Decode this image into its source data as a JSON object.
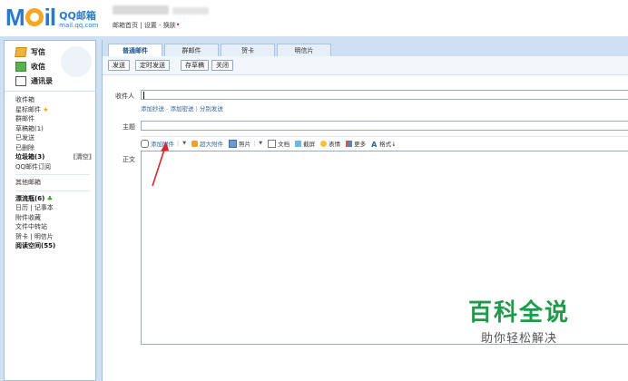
{
  "header": {
    "logo_text": "M",
    "logo_text2": "il",
    "logo_cn": "QQ邮箱",
    "logo_url": "mail.qq.com",
    "links": [
      "邮箱首页",
      "设置",
      "换肤"
    ]
  },
  "sidebar": {
    "actions": [
      {
        "label": "写信",
        "icon": "pencil-icon"
      },
      {
        "label": "收信",
        "icon": "inbox-icon"
      },
      {
        "label": "通讯录",
        "icon": "contacts-icon"
      }
    ],
    "folders": [
      {
        "label": "收件箱"
      },
      {
        "label": "星标邮件"
      },
      {
        "label": "群邮件"
      },
      {
        "label": "草稿箱(1)"
      },
      {
        "label": "已发送"
      },
      {
        "label": "已删除"
      },
      {
        "label": "垃圾箱(3)",
        "action": "[清空]"
      },
      {
        "label": "QQ邮件订阅"
      }
    ],
    "other": "其他邮箱",
    "apps": {
      "drift": "漂流瓶(6)",
      "calendar": "日历",
      "notes": "记事本",
      "attach": "附件收藏",
      "transfer": "文件中转站",
      "card": "贺卡",
      "postcard": "明信片",
      "reading": "阅读空间(55)"
    }
  },
  "tabs": [
    "普通邮件",
    "群邮件",
    "贺卡",
    "明信片"
  ],
  "toolbar": [
    "发送",
    "定时发送",
    "存草稿",
    "关闭"
  ],
  "compose": {
    "to_label": "收件人",
    "to_links": [
      "添加抄送",
      "添加密送",
      "分别发送"
    ],
    "subject_label": "主题",
    "body_label": "正文"
  },
  "editbar": {
    "attach": "添加附件",
    "big_attach": "超大附件",
    "photo": "照片",
    "doc": "文档",
    "screenshot": "截屏",
    "emoji": "表情",
    "more": "更多",
    "format": "格式↓"
  },
  "watermark": {
    "title": "百科全说",
    "subtitle": "助你轻松解决"
  }
}
